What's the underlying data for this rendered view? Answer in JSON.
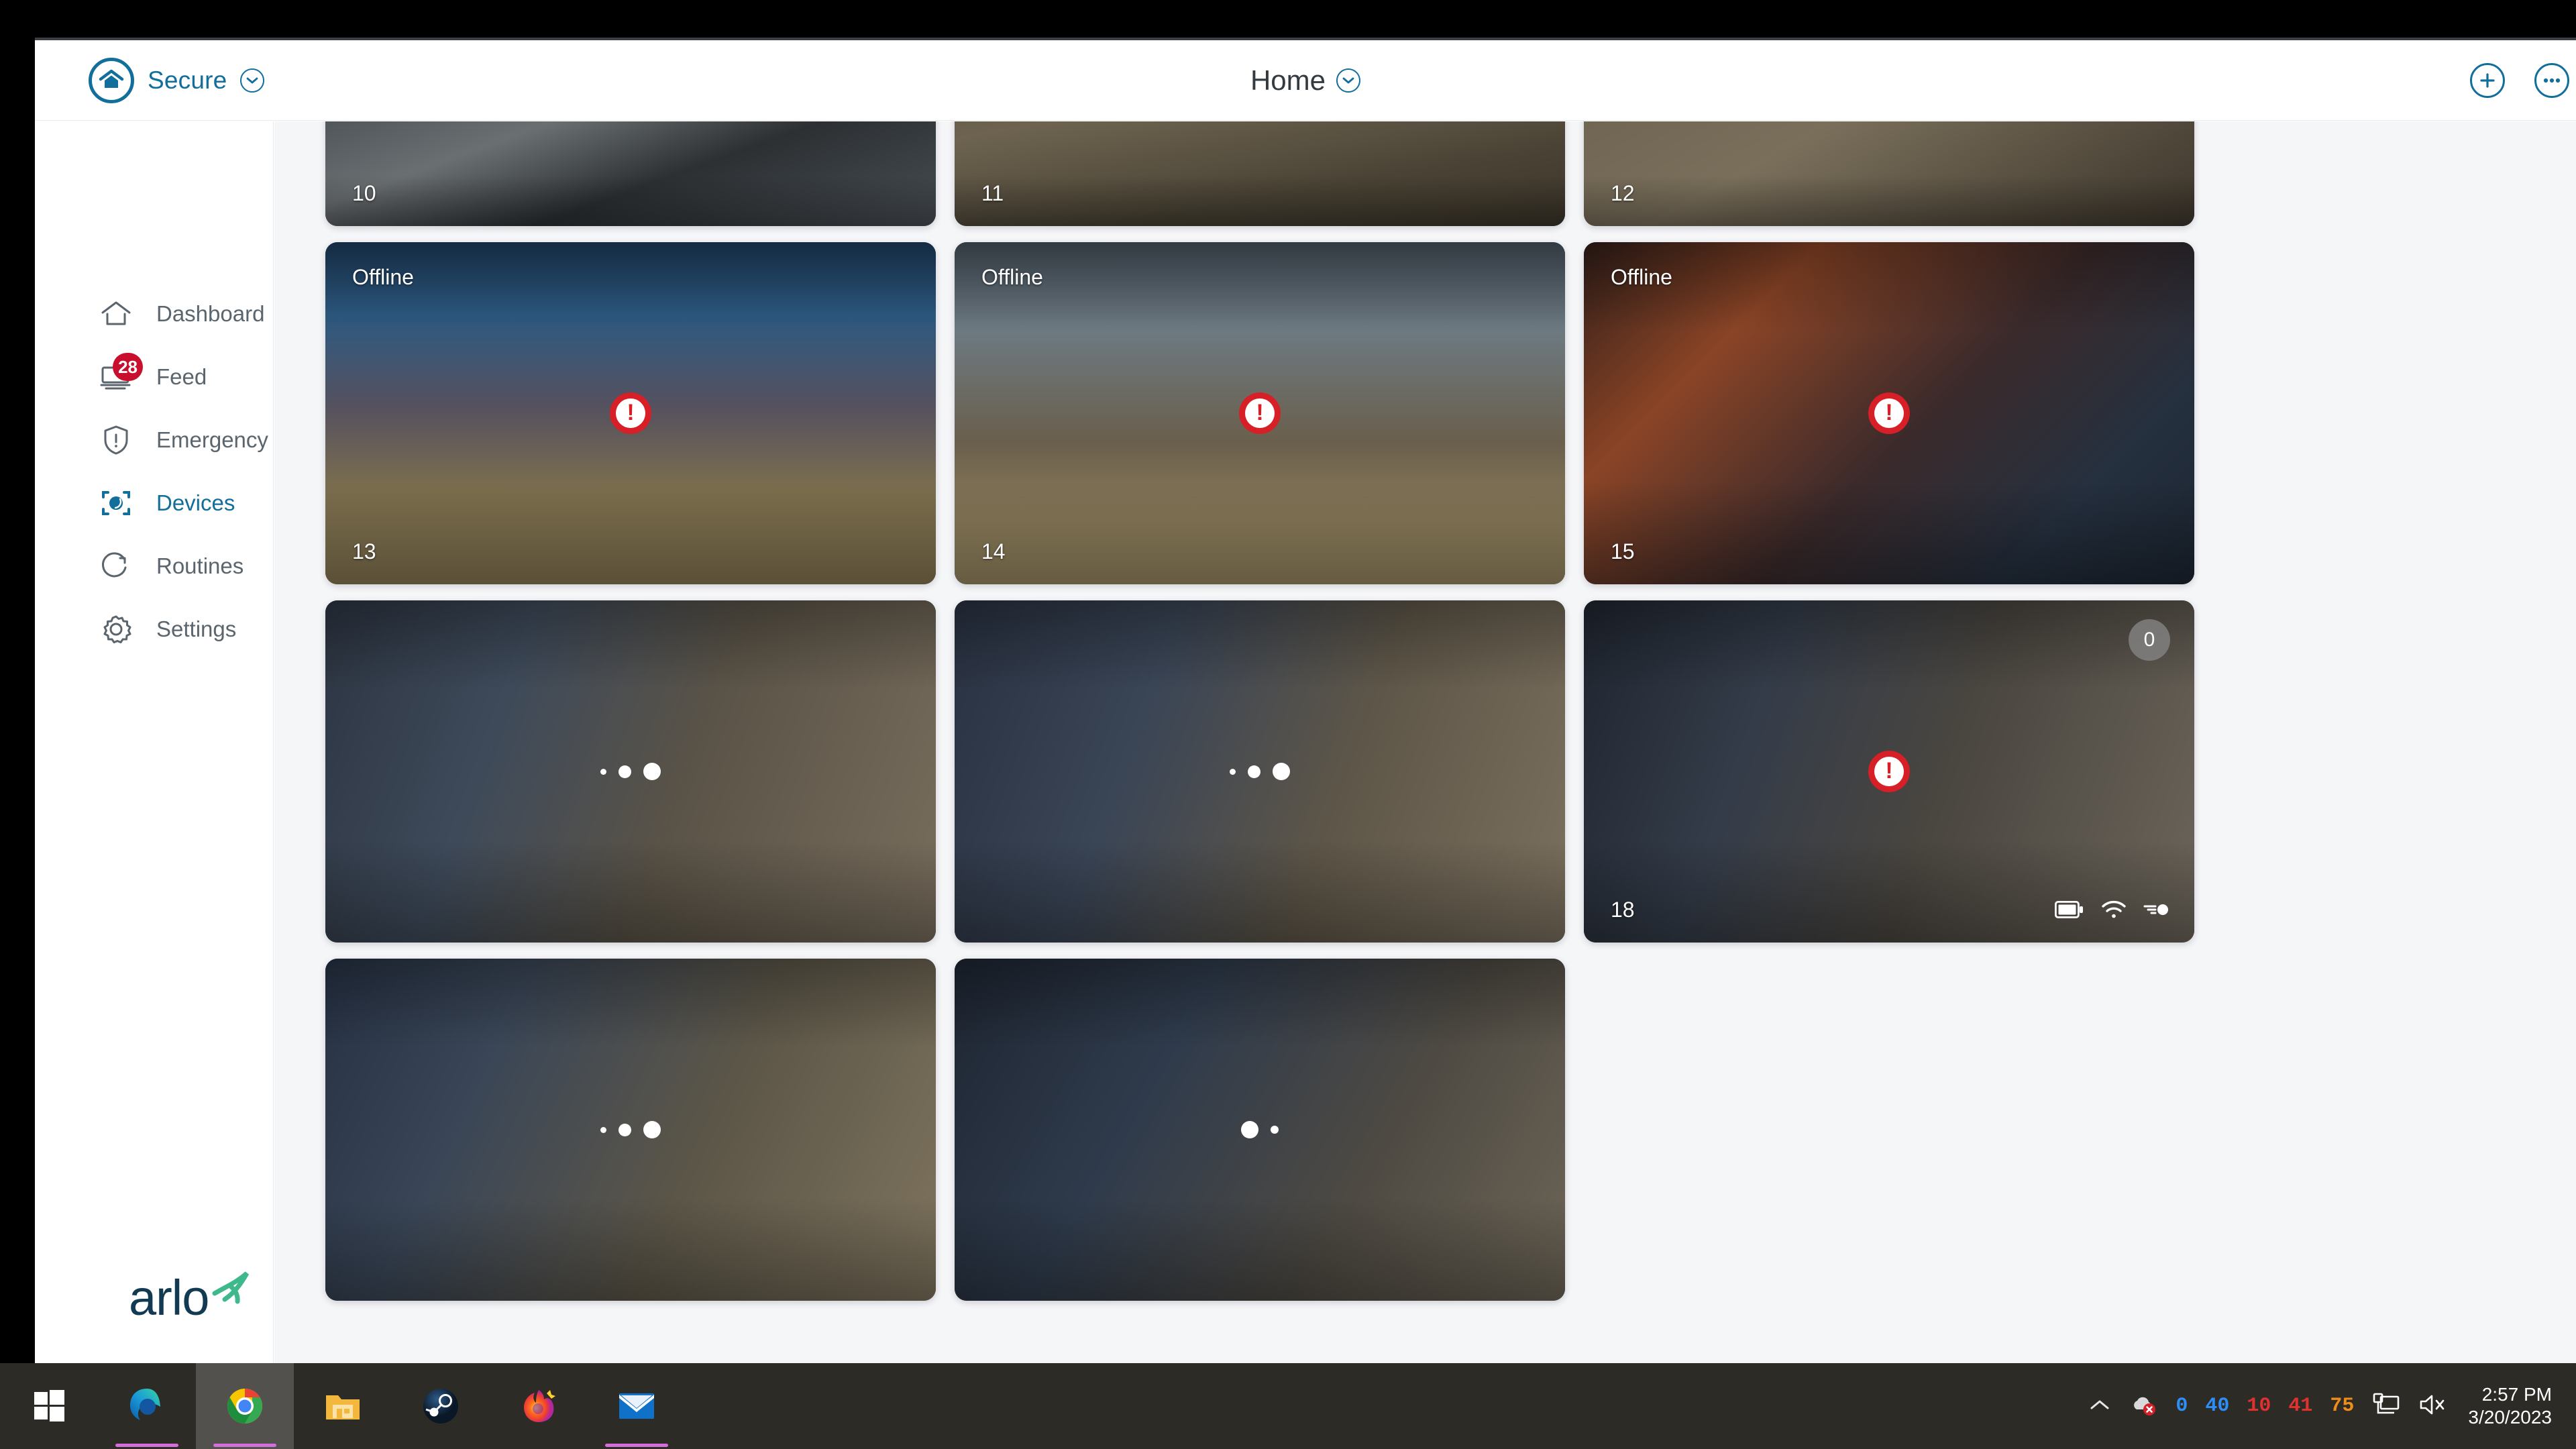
{
  "header": {
    "mode_label": "Secure",
    "mode_icon": "home-shield-icon",
    "mode_chevron_icon": "chevron-down-icon",
    "location_title": "Home",
    "location_chevron_icon": "chevron-down-icon",
    "add_icon": "plus-circle-icon",
    "more_icon": "more-options-icon",
    "accent_color": "#126E9B"
  },
  "sidebar": {
    "items": [
      {
        "label": "Dashboard",
        "icon": "house-icon",
        "badge": "",
        "active": false
      },
      {
        "label": "Feed",
        "icon": "feed-icon",
        "badge": "28",
        "active": false
      },
      {
        "label": "Emergency",
        "icon": "shield-alert-icon",
        "badge": "",
        "active": false
      },
      {
        "label": "Devices",
        "icon": "devices-icon",
        "badge": "",
        "active": true
      },
      {
        "label": "Routines",
        "icon": "routines-icon",
        "badge": "",
        "active": false
      },
      {
        "label": "Settings",
        "icon": "gear-icon",
        "badge": "",
        "active": false
      }
    ],
    "badge_color": "#C8102E",
    "brand": {
      "wordmark": "arlo",
      "mark_icon": "hummingbird-icon",
      "text_color": "#123A52",
      "mark_color": "#3FB98C"
    }
  },
  "main": {
    "cameras": [
      {
        "name": "10",
        "status": "",
        "state": "thumbnail",
        "alert": false,
        "count": "",
        "status_icons": [],
        "tone": "t10",
        "clipped_top": true
      },
      {
        "name": "11",
        "status": "",
        "state": "thumbnail",
        "alert": false,
        "count": "",
        "status_icons": [],
        "tone": "t11",
        "clipped_top": true
      },
      {
        "name": "12",
        "status": "",
        "state": "thumbnail",
        "alert": false,
        "count": "",
        "status_icons": [],
        "tone": "t12",
        "clipped_top": true
      },
      {
        "name": "13",
        "status": "Offline",
        "state": "thumbnail",
        "alert": true,
        "count": "",
        "status_icons": [],
        "tone": "t13",
        "clipped_top": false
      },
      {
        "name": "14",
        "status": "Offline",
        "state": "thumbnail",
        "alert": true,
        "count": "",
        "status_icons": [],
        "tone": "t14",
        "clipped_top": false
      },
      {
        "name": "15",
        "status": "Offline",
        "state": "thumbnail",
        "alert": true,
        "count": "",
        "status_icons": [],
        "tone": "t15",
        "clipped_top": false
      },
      {
        "name": "",
        "status": "",
        "state": "loading",
        "alert": false,
        "count": "",
        "status_icons": [],
        "tone": "t16",
        "clipped_top": false,
        "spinner_phase": "asc"
      },
      {
        "name": "",
        "status": "",
        "state": "loading",
        "alert": false,
        "count": "",
        "status_icons": [],
        "tone": "t17",
        "clipped_top": false,
        "spinner_phase": "asc"
      },
      {
        "name": "18",
        "status": "",
        "state": "thumbnail",
        "alert": true,
        "count": "0",
        "status_icons": [
          "battery-icon",
          "wifi-icon",
          "motion-icon"
        ],
        "tone": "t18",
        "clipped_top": false
      },
      {
        "name": "",
        "status": "",
        "state": "loading",
        "alert": false,
        "count": "",
        "status_icons": [],
        "tone": "t19",
        "clipped_top": false,
        "spinner_phase": "asc"
      },
      {
        "name": "",
        "status": "",
        "state": "loading",
        "alert": false,
        "count": "",
        "status_icons": [],
        "tone": "t20",
        "clipped_top": false,
        "spinner_phase": "desc"
      }
    ],
    "alert_color": "#D61F26",
    "count_badge_color": "#828282"
  },
  "taskbar": {
    "items": [
      {
        "name": "start-button",
        "label": "Start",
        "active": false,
        "running": false
      },
      {
        "name": "edge-taskbar-button",
        "label": "Microsoft Edge",
        "active": false,
        "running": true
      },
      {
        "name": "chrome-taskbar-button",
        "label": "Google Chrome",
        "active": true,
        "running": true
      },
      {
        "name": "explorer-taskbar-button",
        "label": "File Explorer",
        "active": false,
        "running": false
      },
      {
        "name": "steam-taskbar-button",
        "label": "Steam",
        "active": false,
        "running": false
      },
      {
        "name": "firefox-taskbar-button",
        "label": "Firefox",
        "active": false,
        "running": false
      },
      {
        "name": "mail-taskbar-button",
        "label": "Mail",
        "active": false,
        "running": true
      }
    ],
    "tray": {
      "overflow_icon": "chevron-up-icon",
      "onedrive_icon": "onedrive-error-icon",
      "monitor_values": [
        {
          "value": "0",
          "color": "#2d8ef5"
        },
        {
          "value": "40",
          "color": "#2d8ef5"
        },
        {
          "value": "10",
          "color": "#e03131"
        },
        {
          "value": "41",
          "color": "#e03131"
        },
        {
          "value": "75",
          "color": "#f08c1a"
        }
      ],
      "network_icon": "network-icon",
      "volume_icon": "volume-muted-icon"
    },
    "clock": {
      "time": "2:57 PM",
      "date": "3/20/2023"
    }
  }
}
